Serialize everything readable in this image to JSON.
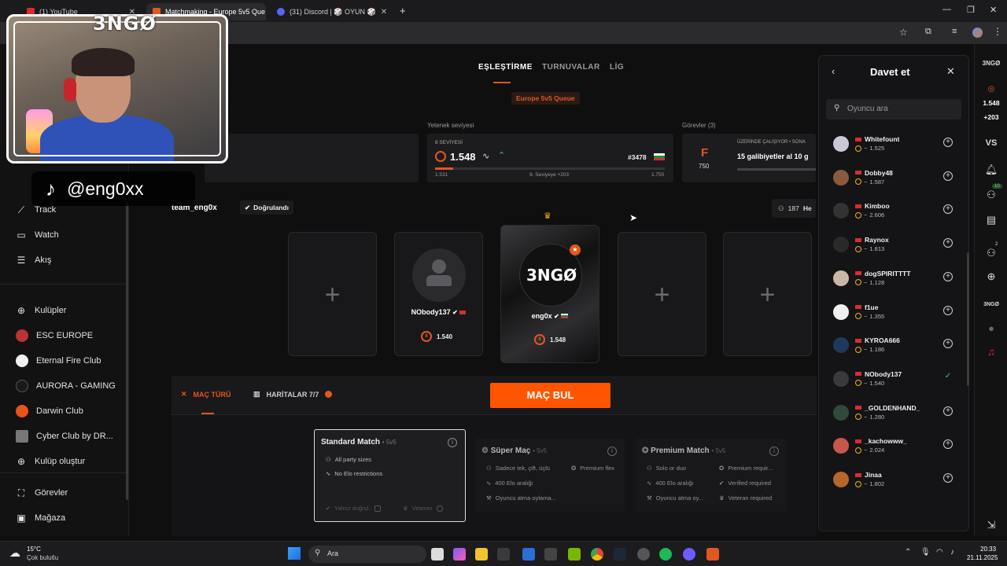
{
  "browser": {
    "tabs": [
      {
        "title": "(1) YouTube",
        "icon": "youtube-icon",
        "color": "#e0282b"
      },
      {
        "title": "Matchmaking - Europe 5v5 Que",
        "icon": "faceit-icon",
        "color": "#e2571e"
      },
      {
        "title": "(31) Discord | 🎲 OYUN 🎲",
        "icon": "discord-icon",
        "color": "#5865f2"
      }
    ],
    "new_tab": "+",
    "window_controls": [
      "—",
      "❐",
      "✕"
    ]
  },
  "stream_overlay": {
    "brand": "3NGØ",
    "tiktok_handle": "@eng0xx"
  },
  "sidebar": {
    "items_top": [
      {
        "label": "Track",
        "icon": "chart-line-icon"
      },
      {
        "label": "Watch",
        "icon": "tv-icon"
      },
      {
        "label": "Akış",
        "icon": "feed-icon"
      }
    ],
    "clubs": [
      {
        "label": "Kulüpler",
        "icon": "globe-icon",
        "color": ""
      },
      {
        "label": "ESC EUROPE",
        "icon": "club-logo",
        "color": "#b33"
      },
      {
        "label": "Eternal Fire Club",
        "icon": "club-logo",
        "color": "#f1f1f1"
      },
      {
        "label": "AURORA - GAMING",
        "icon": "club-logo",
        "color": "#1a1a1a"
      },
      {
        "label": "Darwin Club",
        "icon": "club-logo",
        "color": "#e8541b"
      },
      {
        "label": "Cyber Club by DR...",
        "icon": "club-logo",
        "color": "#777"
      },
      {
        "label": "Kulüp oluştur",
        "icon": "plus-circle-icon",
        "color": ""
      }
    ],
    "items_bottom": [
      {
        "label": "Görevler",
        "icon": "tasks-icon"
      },
      {
        "label": "Mağaza",
        "icon": "store-icon"
      }
    ]
  },
  "main": {
    "tabs": [
      {
        "label": "EŞLEŞTİRME",
        "active": true
      },
      {
        "label": "TURNUVALAR",
        "active": false
      },
      {
        "label": "LİG",
        "active": false
      }
    ],
    "queue_badge": "Europe 5v5 Queue",
    "skill": {
      "section_label": "Yetenek seviyesi",
      "level_label": "8 SEVİYESİ",
      "elo": "1.548",
      "rank": "#3478",
      "progress_min": "1.531",
      "progress_max": "1.750",
      "progress_note": "9. Seviyeye +203",
      "progress_fraction": 0.08
    },
    "missions": {
      "section_label": "Görevler (3)",
      "grade": "F",
      "grade_points": "750",
      "subtitle": "ÜZERİNDE ÇALIŞIYOR • SONA",
      "title": "15 galibiyetler al 10 g"
    },
    "team": {
      "name": "team_eng0x",
      "verified": "Doğrulandı",
      "member_count": "187",
      "member_label": "He"
    },
    "players": [
      {
        "name": "NObody137",
        "elo": "1.540",
        "level": "8"
      },
      {
        "name": "eng0x",
        "elo": "1.548",
        "level": "8",
        "logo": "3NGØ"
      }
    ],
    "empty_slot_symbol": "+",
    "bottom_tabs": [
      {
        "label": "MAÇ TÜRÜ",
        "active": true
      },
      {
        "label": "HARİTALAR 7/7",
        "active": false
      }
    ],
    "find_match": "MAÇ BUL",
    "modes": [
      {
        "title": "Standard Match",
        "sub": "• 5v5",
        "lines": [
          "All party sizes",
          "No Elo restrictions"
        ],
        "toggles": [
          "Yalnız doğrul.",
          "Veteran"
        ],
        "selected": true
      },
      {
        "title": "Süper Maç",
        "sub": "• 5v5",
        "lines": [
          "Sadece tek, çift, üçlü",
          "400 Elo aralığı",
          "Oyuncu atma oylama..."
        ],
        "extras": [
          "Premium flex"
        ],
        "selected": false
      },
      {
        "title": "Premium Match",
        "sub": "• 5v5",
        "lines": [
          "Solo or duo",
          "400 Elo aralığı",
          "Oyuncu atma oy..."
        ],
        "extras": [
          "Premium requir...",
          "Verified required",
          "Veteran required"
        ],
        "selected": false
      }
    ]
  },
  "invite": {
    "title": "Davet et",
    "search_placeholder": "Oyuncu ara",
    "players": [
      {
        "name": "Whitefount",
        "elo": "1.525",
        "color": "#c9c9d6",
        "invited": false
      },
      {
        "name": "Dobby48",
        "elo": "1.587",
        "color": "#8a5a3c",
        "invited": false
      },
      {
        "name": "Kimboo",
        "elo": "2.606",
        "color": "#333",
        "invited": false
      },
      {
        "name": "Raynox",
        "elo": "1.813",
        "color": "#2a2a2a",
        "invited": false
      },
      {
        "name": "dogSPIRITTTT",
        "elo": "1.128",
        "color": "#cbb7a8",
        "invited": false
      },
      {
        "name": "f1ue",
        "elo": "1.355",
        "color": "#f0f0f0",
        "invited": false
      },
      {
        "name": "KYROA666",
        "elo": "1.186",
        "color": "#1e3a5a",
        "invited": false
      },
      {
        "name": "NObody137",
        "elo": "1.540",
        "color": "#3a3a3c",
        "invited": true
      },
      {
        "name": "_GOLDENHAND_",
        "elo": "1.280",
        "color": "#2e4a3a",
        "invited": false
      },
      {
        "name": "_kachowww_",
        "elo": "2.024",
        "color": "#c9564a",
        "invited": false
      },
      {
        "name": "Jinaa",
        "elo": "1.802",
        "color": "#b5682a",
        "invited": false
      }
    ]
  },
  "rail": {
    "elo": "1.548",
    "delta": "+203",
    "vs": "VS",
    "friends_badge": "10",
    "party_badge": "2"
  },
  "taskbar": {
    "weather_temp": "15°C",
    "weather_desc": "Çok bulutlu",
    "search": "Ara",
    "time": "20:33",
    "date": "21.11.2025"
  },
  "colors": {
    "accent": "#e2571e",
    "bg": "#0f0f10",
    "panel": "#1c1c1e"
  }
}
